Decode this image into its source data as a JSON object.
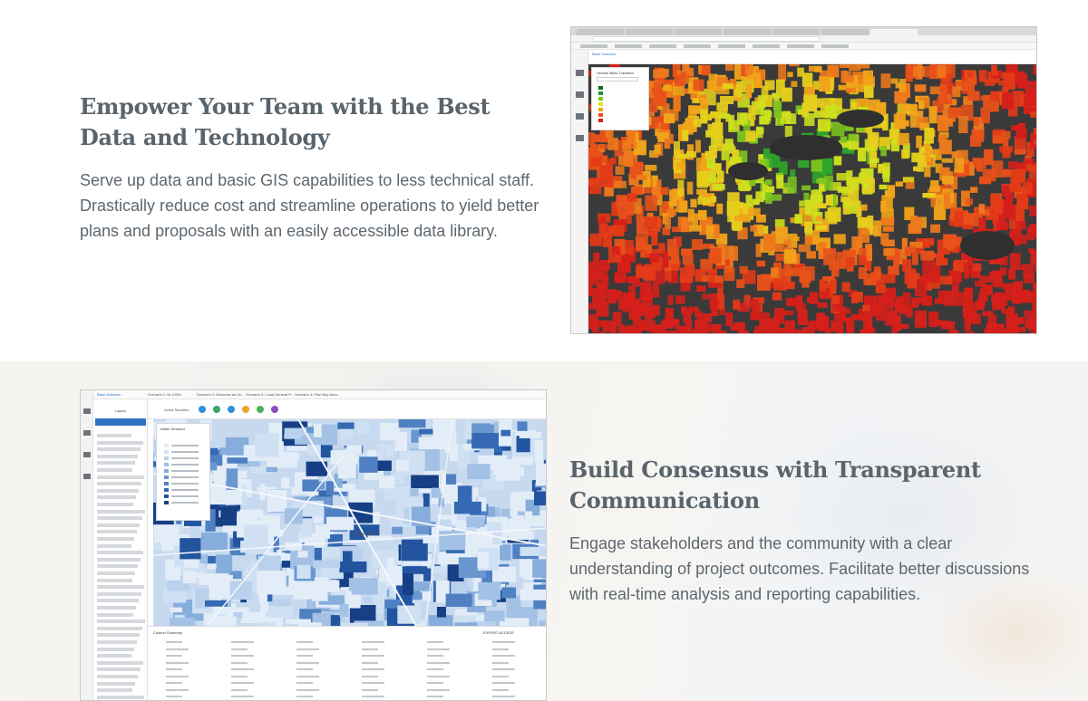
{
  "sections": [
    {
      "title": "Empower Your Team with the Best Data and Technology",
      "body": "Serve up data and basic GIS capabilities to less technical staff. Drastically reduce cost and streamline operations to yield better plans and proposals with an easily accessible data library."
    },
    {
      "title": "Build Consensus with Transparent Communication",
      "body": "Engage stakeholders and the community with a clear understanding of project outcomes. Facilitate better discussions with real-time analysis and reporting capabilities."
    }
  ],
  "screenshot1": {
    "scenario_label": "Base Scenario",
    "legend_title": "Vehicle Miles Travelled",
    "legend_colors": [
      "#0a6b1f",
      "#1f9a2a",
      "#7cc421",
      "#e6e21c",
      "#f2a41a",
      "#e8521a",
      "#d5201a"
    ]
  },
  "screenshot2": {
    "tabs": [
      "Base Scenario",
      "Scenario 1: Nr.USEb",
      "Scenario 2: Business as Us...",
      "Scenario 3: Local General P...",
      "Scenario 4: Plan Bay Area..."
    ],
    "layers_title": "Layers",
    "toolbar_label": "Active Modules",
    "legend_title": "Water Demand",
    "city_label": "Santa Rosa",
    "table_title": "Column Summary",
    "export_label": "EXPORT ACCESS",
    "legend_colors": [
      "#e3edf8",
      "#cfe0f3",
      "#b9d1ec",
      "#a2c1e4",
      "#86addb",
      "#6a97cf",
      "#4f80c2",
      "#3669b3",
      "#23549f",
      "#163f85"
    ],
    "tool_colors": [
      "#2f8fd8",
      "#35a86a",
      "#2f8fd8",
      "#f0a32a",
      "#49b05a",
      "#8a4fb8"
    ]
  }
}
